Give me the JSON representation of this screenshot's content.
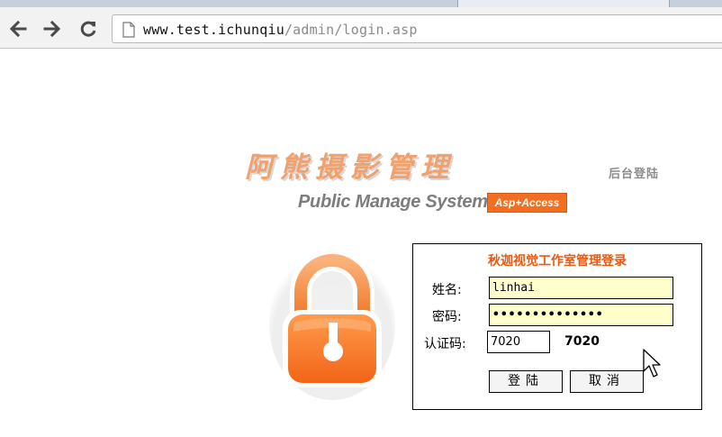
{
  "browser": {
    "url_host": "www.test.ichunqiu",
    "url_path": "/admin/login.asp",
    "icons": {
      "back": "back-arrow-icon",
      "forward": "forward-arrow-icon",
      "reload": "reload-icon",
      "page": "page-icon"
    }
  },
  "header": {
    "logo_cn": "阿熊摄影管理",
    "logo_en": "Public Manage System",
    "logo_badge": "Asp+Access",
    "admin_tag": "后台登陆"
  },
  "login": {
    "title": "秋迦视觉工作室管理登录",
    "username_label": "姓名:",
    "username_value": "linhai",
    "password_label": "密码:",
    "password_value": "••••••••••••••",
    "captcha_label": "认证码:",
    "captcha_input": "7020",
    "captcha_display": "7020",
    "submit_label": "登陆",
    "cancel_label": "取消"
  },
  "colors": {
    "accent_orange": "#f26f21",
    "logo_orange": "#f0a16e",
    "field_bg": "#ffffcc",
    "title_text": "#e85a12"
  }
}
